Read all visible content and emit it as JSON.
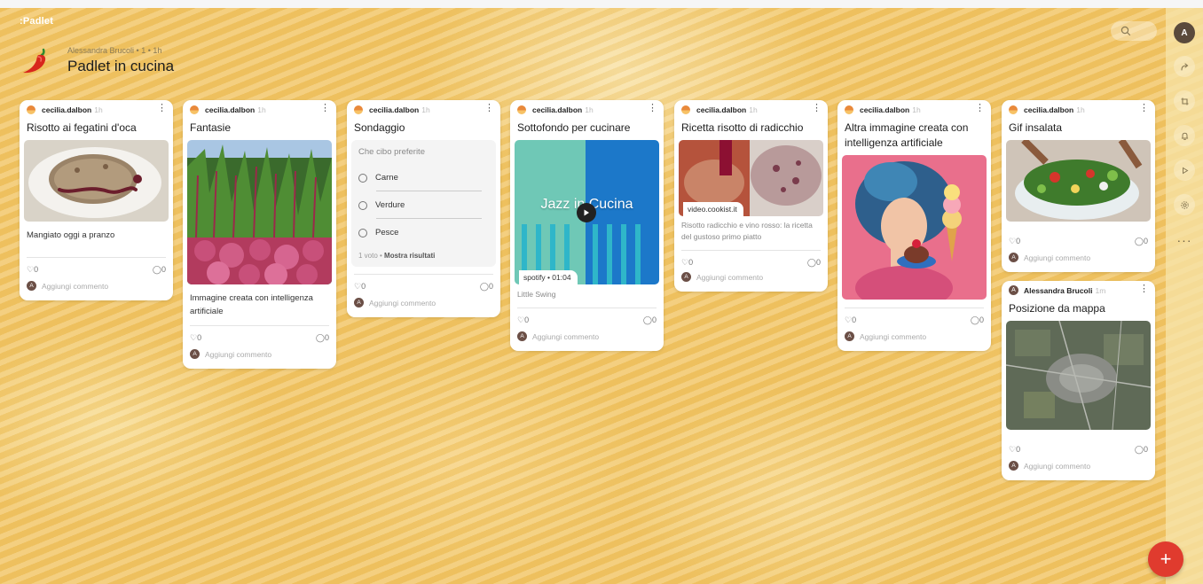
{
  "app": {
    "logo": ":Padlet"
  },
  "wall": {
    "meta": "Alessandra Brucoli • 1 • 1h",
    "title": "Padlet in cucina"
  },
  "rail": {
    "avatar_letter": "A",
    "more": "···"
  },
  "fab": {
    "label": "+"
  },
  "colors": {
    "accent": "#e03b2e",
    "card": "#ffffff",
    "background": "#f1c564"
  },
  "cards": [
    {
      "author": "cecilia.dalbon",
      "time": "1h",
      "title": "Risotto ai fegatini d'oca",
      "text": "Mangiato oggi a pranzo",
      "likes": "0",
      "comments": "0",
      "add_comment": "Aggiungi commento"
    },
    {
      "author": "cecilia.dalbon",
      "time": "1h",
      "title": "Fantasie",
      "text": "Immagine creata con intelligenza artificiale",
      "likes": "0",
      "comments": "0",
      "add_comment": "Aggiungi commento"
    },
    {
      "author": "cecilia.dalbon",
      "time": "1h",
      "title": "Sondaggio",
      "poll": {
        "question": "Che cibo preferite",
        "options": [
          "Carne",
          "Verdure",
          "Pesce"
        ],
        "votes": "1 voto",
        "show_results": "Mostra risultati"
      },
      "likes": "0",
      "comments": "0",
      "add_comment": "Aggiungi commento"
    },
    {
      "author": "cecilia.dalbon",
      "time": "1h",
      "title": "Sottofondo per cucinare",
      "media_text": "Jazz in Cucina",
      "source": "spotify",
      "duration": "01:04",
      "caption": "Little Swing",
      "likes": "0",
      "comments": "0",
      "add_comment": "Aggiungi commento"
    },
    {
      "author": "cecilia.dalbon",
      "time": "1h",
      "title": "Ricetta risotto di radicchio",
      "source": "video.cookist.it",
      "text": "Risotto radicchio e vino rosso: la ricetta del gustoso primo piatto",
      "likes": "0",
      "comments": "0",
      "add_comment": "Aggiungi commento"
    },
    {
      "author": "cecilia.dalbon",
      "time": "1h",
      "title": "Altra immagine creata con intelligenza artificiale",
      "likes": "0",
      "comments": "0",
      "add_comment": "Aggiungi commento"
    },
    {
      "author": "cecilia.dalbon",
      "time": "1h",
      "title": "Gif insalata",
      "likes": "0",
      "comments": "0",
      "add_comment": "Aggiungi commento"
    },
    {
      "author": "Alessandra Brucoli",
      "time": "1m",
      "author_initial": "A",
      "title": "Posizione da mappa",
      "likes": "0",
      "comments": "0",
      "add_comment": "Aggiungi commento"
    }
  ],
  "comment_avatar": "A"
}
